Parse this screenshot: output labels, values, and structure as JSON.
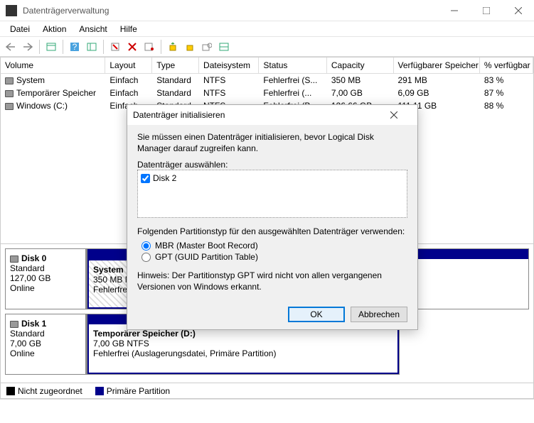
{
  "window": {
    "title": "Datenträgerverwaltung"
  },
  "menu": {
    "file": "Datei",
    "action": "Aktion",
    "view": "Ansicht",
    "help": "Hilfe"
  },
  "columns": {
    "volume": "Volume",
    "layout": "Layout",
    "type": "Type",
    "fs": "Dateisystem",
    "status": "Status",
    "capacity": "Capacity",
    "free": "Verfügbarer Speicher",
    "pct": "% verfügbar"
  },
  "volumes": [
    {
      "name": "System",
      "layout": "Einfach",
      "type": "Standard",
      "fs": "NTFS",
      "status": "Fehlerfrei (S...",
      "capacity": "350 MB",
      "free": "291 MB",
      "pct": "83 %"
    },
    {
      "name": "Temporärer Speicher",
      "layout": "Einfach",
      "type": "Standard",
      "fs": "NTFS",
      "status": "Fehlerfrei (...",
      "capacity": "7,00 GB",
      "free": "6,09 GB",
      "pct": "87 %"
    },
    {
      "name": "Windows (C:)",
      "layout": "Einfach",
      "type": "Standard",
      "fs": "NTFS",
      "status": "Fehlerfrei (B...",
      "capacity": "126,66 GB",
      "free": "111,11 GB",
      "pct": "88 %"
    }
  ],
  "disks": {
    "d0": {
      "name": "Disk 0",
      "type": "Standard",
      "size": "127,00 GB",
      "state": "Online",
      "p0": {
        "name": "System",
        "line2": "350 MB NTFS",
        "line3": "Fehlerfrei (S..."
      }
    },
    "d1": {
      "name": "Disk 1",
      "type": "Standard",
      "size": "7,00 GB",
      "state": "Online",
      "p0": {
        "name": "Temporärer Speicher (D:)",
        "line2": "7,00 GB NTFS",
        "line3": "Fehlerfrei (Auslagerungsdatei, Primäre Partition)"
      }
    }
  },
  "legend": {
    "unalloc": "Nicht zugeordnet",
    "primary": "Primäre Partition"
  },
  "dialog": {
    "title": "Datenträger initialisieren",
    "instr": "Sie müssen einen Datenträger initialisieren, bevor Logical Disk Manager darauf zugreifen kann.",
    "selectLbl": "Datenträger auswählen:",
    "diskItem": "Disk 2",
    "styleLbl": "Folgenden Partitionstyp für den ausgewählten Datenträger verwenden:",
    "mbr": "MBR (Master Boot Record)",
    "gpt": "GPT (GUID Partition Table)",
    "hint": "Hinweis: Der Partitionstyp GPT wird nicht von allen vergangenen Versionen von Windows erkannt.",
    "ok": "OK",
    "cancel": "Abbrechen"
  }
}
